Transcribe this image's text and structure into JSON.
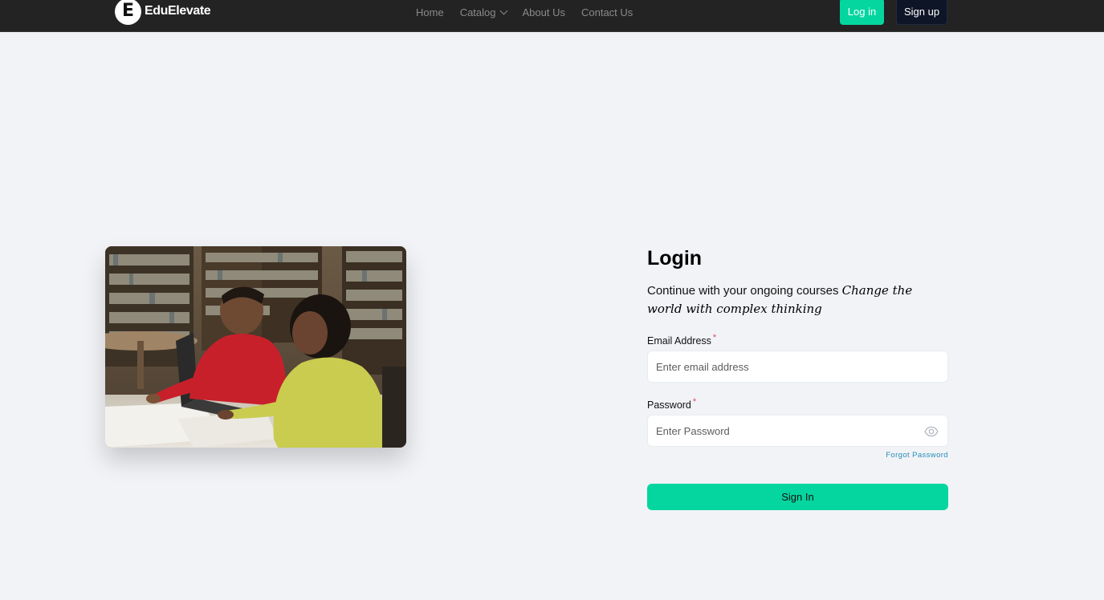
{
  "navbar": {
    "logo_letter": "E",
    "logo_text": "EduElevate",
    "links": [
      {
        "label": "Home"
      },
      {
        "label": "Catalog",
        "icon": "chevron-down-icon"
      },
      {
        "label": "About Us"
      },
      {
        "label": "Contact Us"
      }
    ],
    "login_label": "Log in",
    "signup_label": "Sign up"
  },
  "hero": {
    "image_subject": "two students studying with a laptop in a library"
  },
  "login": {
    "title": "Login",
    "subtitle_plain": "Continue with your ongoing courses",
    "subtitle_highlight": "Change the world with complex thinking",
    "email_label": "Email Address",
    "email_placeholder": "Enter email address",
    "password_label": "Password",
    "password_placeholder": "Enter Password",
    "required_mark": "*",
    "forgot_label": "Forgot Password",
    "submit_label": "Sign In"
  },
  "colors": {
    "accent": "#05d6a0",
    "navbar_bg": "#232323",
    "page_bg": "#f1f3f7",
    "signup_bg": "#0d1526",
    "link": "#2a8fb5",
    "required": "#e5484d"
  }
}
